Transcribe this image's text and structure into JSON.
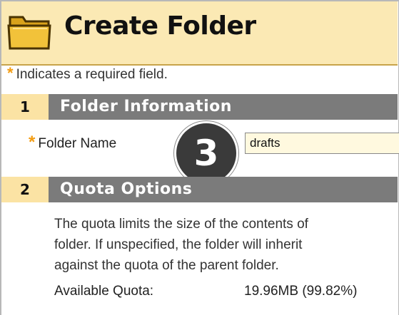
{
  "header": {
    "title": "Create Folder",
    "icon": "folder-icon"
  },
  "required_note": {
    "marker": "*",
    "text": "Indicates a required field."
  },
  "sections": [
    {
      "number": "1",
      "title": "Folder Information"
    },
    {
      "number": "2",
      "title": "Quota Options"
    }
  ],
  "folder_name": {
    "marker": "*",
    "label": "Folder Name",
    "value": "drafts"
  },
  "step_badge": "3",
  "quota": {
    "description_lines": [
      "The quota limits the size of the contents of",
      "folder. If unspecified, the folder will inherit",
      "against the quota of the parent folder."
    ],
    "available_label": "Available Quota:",
    "available_value": "19.96MB (99.82%)"
  },
  "colors": {
    "header_bg": "#fbe9b4",
    "section_bar": "#7b7b7b",
    "section_num_bg": "#fbe3a4",
    "required_star": "#f39c12",
    "input_bg": "#fff9df"
  }
}
